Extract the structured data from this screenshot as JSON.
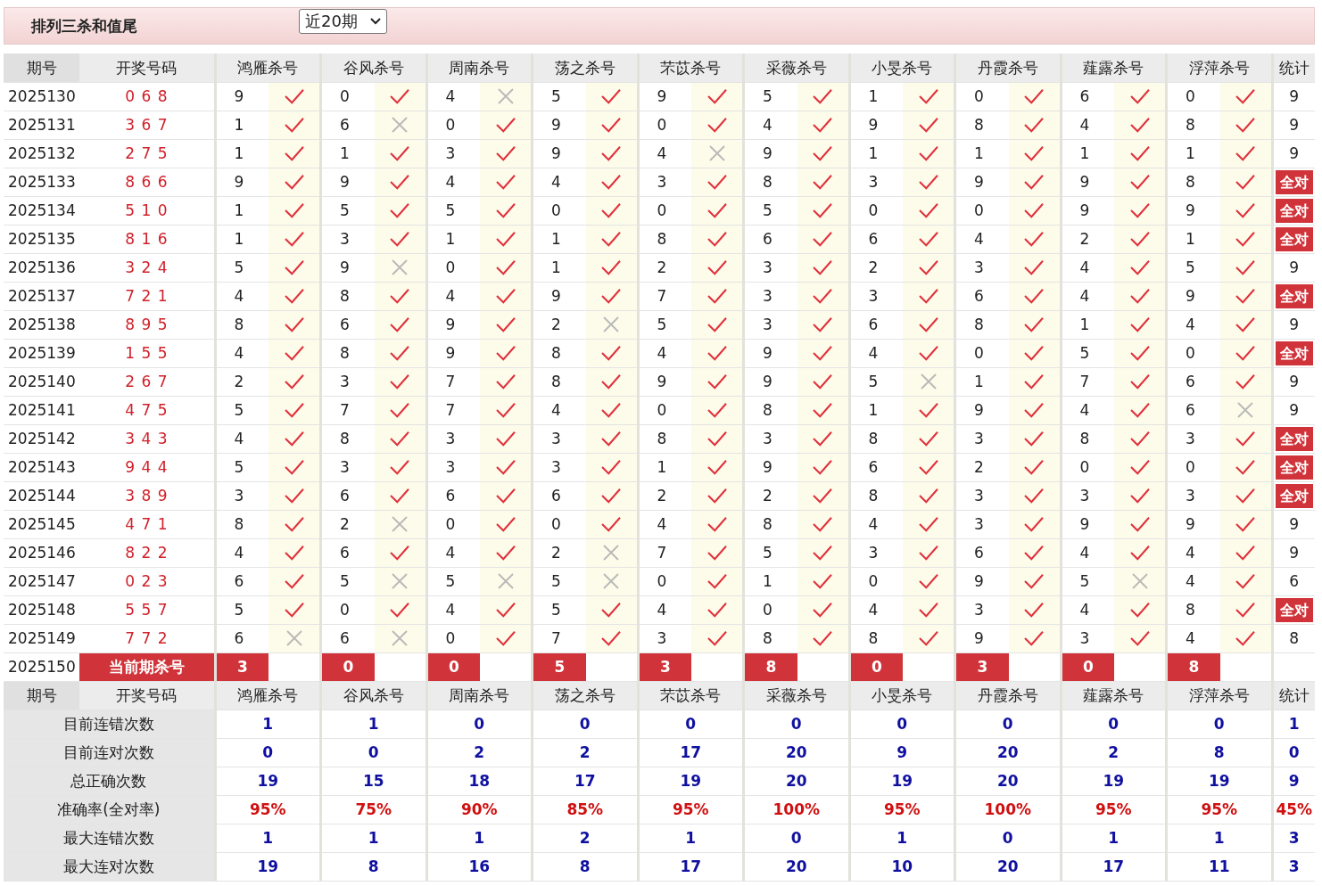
{
  "title": "排列三杀和值尾",
  "period_select": {
    "value": "近20期"
  },
  "columns": {
    "issue": "期号",
    "draw": "开奖号码",
    "experts": [
      "鸿雁杀号",
      "谷风杀号",
      "周南杀号",
      "荡之杀号",
      "芣苡杀号",
      "采薇杀号",
      "小旻杀号",
      "丹霞杀号",
      "薤露杀号",
      "浮萍杀号"
    ],
    "stat": "统计"
  },
  "rows": [
    {
      "issue": "2025130",
      "draw": "0 6 8",
      "kills": [
        {
          "n": "9",
          "hit": true
        },
        {
          "n": "0",
          "hit": true
        },
        {
          "n": "4",
          "hit": false
        },
        {
          "n": "5",
          "hit": true
        },
        {
          "n": "9",
          "hit": true
        },
        {
          "n": "5",
          "hit": true
        },
        {
          "n": "1",
          "hit": true
        },
        {
          "n": "0",
          "hit": true
        },
        {
          "n": "6",
          "hit": true
        },
        {
          "n": "0",
          "hit": true
        }
      ],
      "stat": {
        "text": "9",
        "all_correct": false
      }
    },
    {
      "issue": "2025131",
      "draw": "3 6 7",
      "kills": [
        {
          "n": "1",
          "hit": true
        },
        {
          "n": "6",
          "hit": false
        },
        {
          "n": "0",
          "hit": true
        },
        {
          "n": "9",
          "hit": true
        },
        {
          "n": "0",
          "hit": true
        },
        {
          "n": "4",
          "hit": true
        },
        {
          "n": "9",
          "hit": true
        },
        {
          "n": "8",
          "hit": true
        },
        {
          "n": "4",
          "hit": true
        },
        {
          "n": "8",
          "hit": true
        }
      ],
      "stat": {
        "text": "9",
        "all_correct": false
      }
    },
    {
      "issue": "2025132",
      "draw": "2 7 5",
      "kills": [
        {
          "n": "1",
          "hit": true
        },
        {
          "n": "1",
          "hit": true
        },
        {
          "n": "3",
          "hit": true
        },
        {
          "n": "9",
          "hit": true
        },
        {
          "n": "4",
          "hit": false
        },
        {
          "n": "9",
          "hit": true
        },
        {
          "n": "1",
          "hit": true
        },
        {
          "n": "1",
          "hit": true
        },
        {
          "n": "1",
          "hit": true
        },
        {
          "n": "1",
          "hit": true
        }
      ],
      "stat": {
        "text": "9",
        "all_correct": false
      }
    },
    {
      "issue": "2025133",
      "draw": "8 6 6",
      "kills": [
        {
          "n": "9",
          "hit": true
        },
        {
          "n": "9",
          "hit": true
        },
        {
          "n": "4",
          "hit": true
        },
        {
          "n": "4",
          "hit": true
        },
        {
          "n": "3",
          "hit": true
        },
        {
          "n": "8",
          "hit": true
        },
        {
          "n": "3",
          "hit": true
        },
        {
          "n": "9",
          "hit": true
        },
        {
          "n": "9",
          "hit": true
        },
        {
          "n": "8",
          "hit": true
        }
      ],
      "stat": {
        "text": "全对",
        "all_correct": true
      }
    },
    {
      "issue": "2025134",
      "draw": "5 1 0",
      "kills": [
        {
          "n": "1",
          "hit": true
        },
        {
          "n": "5",
          "hit": true
        },
        {
          "n": "5",
          "hit": true
        },
        {
          "n": "0",
          "hit": true
        },
        {
          "n": "0",
          "hit": true
        },
        {
          "n": "5",
          "hit": true
        },
        {
          "n": "0",
          "hit": true
        },
        {
          "n": "0",
          "hit": true
        },
        {
          "n": "9",
          "hit": true
        },
        {
          "n": "9",
          "hit": true
        }
      ],
      "stat": {
        "text": "全对",
        "all_correct": true
      }
    },
    {
      "issue": "2025135",
      "draw": "8 1 6",
      "kills": [
        {
          "n": "1",
          "hit": true
        },
        {
          "n": "3",
          "hit": true
        },
        {
          "n": "1",
          "hit": true
        },
        {
          "n": "1",
          "hit": true
        },
        {
          "n": "8",
          "hit": true
        },
        {
          "n": "6",
          "hit": true
        },
        {
          "n": "6",
          "hit": true
        },
        {
          "n": "4",
          "hit": true
        },
        {
          "n": "2",
          "hit": true
        },
        {
          "n": "1",
          "hit": true
        }
      ],
      "stat": {
        "text": "全对",
        "all_correct": true
      }
    },
    {
      "issue": "2025136",
      "draw": "3 2 4",
      "kills": [
        {
          "n": "5",
          "hit": true
        },
        {
          "n": "9",
          "hit": false
        },
        {
          "n": "0",
          "hit": true
        },
        {
          "n": "1",
          "hit": true
        },
        {
          "n": "2",
          "hit": true
        },
        {
          "n": "3",
          "hit": true
        },
        {
          "n": "2",
          "hit": true
        },
        {
          "n": "3",
          "hit": true
        },
        {
          "n": "4",
          "hit": true
        },
        {
          "n": "5",
          "hit": true
        }
      ],
      "stat": {
        "text": "9",
        "all_correct": false
      }
    },
    {
      "issue": "2025137",
      "draw": "7 2 1",
      "kills": [
        {
          "n": "4",
          "hit": true
        },
        {
          "n": "8",
          "hit": true
        },
        {
          "n": "4",
          "hit": true
        },
        {
          "n": "9",
          "hit": true
        },
        {
          "n": "7",
          "hit": true
        },
        {
          "n": "3",
          "hit": true
        },
        {
          "n": "3",
          "hit": true
        },
        {
          "n": "6",
          "hit": true
        },
        {
          "n": "4",
          "hit": true
        },
        {
          "n": "9",
          "hit": true
        }
      ],
      "stat": {
        "text": "全对",
        "all_correct": true
      }
    },
    {
      "issue": "2025138",
      "draw": "8 9 5",
      "kills": [
        {
          "n": "8",
          "hit": true
        },
        {
          "n": "6",
          "hit": true
        },
        {
          "n": "9",
          "hit": true
        },
        {
          "n": "2",
          "hit": false
        },
        {
          "n": "5",
          "hit": true
        },
        {
          "n": "3",
          "hit": true
        },
        {
          "n": "6",
          "hit": true
        },
        {
          "n": "8",
          "hit": true
        },
        {
          "n": "1",
          "hit": true
        },
        {
          "n": "4",
          "hit": true
        }
      ],
      "stat": {
        "text": "9",
        "all_correct": false
      }
    },
    {
      "issue": "2025139",
      "draw": "1 5 5",
      "kills": [
        {
          "n": "4",
          "hit": true
        },
        {
          "n": "8",
          "hit": true
        },
        {
          "n": "9",
          "hit": true
        },
        {
          "n": "8",
          "hit": true
        },
        {
          "n": "4",
          "hit": true
        },
        {
          "n": "9",
          "hit": true
        },
        {
          "n": "4",
          "hit": true
        },
        {
          "n": "0",
          "hit": true
        },
        {
          "n": "5",
          "hit": true
        },
        {
          "n": "0",
          "hit": true
        }
      ],
      "stat": {
        "text": "全对",
        "all_correct": true
      }
    },
    {
      "issue": "2025140",
      "draw": "2 6 7",
      "kills": [
        {
          "n": "2",
          "hit": true
        },
        {
          "n": "3",
          "hit": true
        },
        {
          "n": "7",
          "hit": true
        },
        {
          "n": "8",
          "hit": true
        },
        {
          "n": "9",
          "hit": true
        },
        {
          "n": "9",
          "hit": true
        },
        {
          "n": "5",
          "hit": false
        },
        {
          "n": "1",
          "hit": true
        },
        {
          "n": "7",
          "hit": true
        },
        {
          "n": "6",
          "hit": true
        }
      ],
      "stat": {
        "text": "9",
        "all_correct": false
      }
    },
    {
      "issue": "2025141",
      "draw": "4 7 5",
      "kills": [
        {
          "n": "5",
          "hit": true
        },
        {
          "n": "7",
          "hit": true
        },
        {
          "n": "7",
          "hit": true
        },
        {
          "n": "4",
          "hit": true
        },
        {
          "n": "0",
          "hit": true
        },
        {
          "n": "8",
          "hit": true
        },
        {
          "n": "1",
          "hit": true
        },
        {
          "n": "9",
          "hit": true
        },
        {
          "n": "4",
          "hit": true
        },
        {
          "n": "6",
          "hit": false
        }
      ],
      "stat": {
        "text": "9",
        "all_correct": false
      }
    },
    {
      "issue": "2025142",
      "draw": "3 4 3",
      "kills": [
        {
          "n": "4",
          "hit": true
        },
        {
          "n": "8",
          "hit": true
        },
        {
          "n": "3",
          "hit": true
        },
        {
          "n": "3",
          "hit": true
        },
        {
          "n": "8",
          "hit": true
        },
        {
          "n": "3",
          "hit": true
        },
        {
          "n": "8",
          "hit": true
        },
        {
          "n": "3",
          "hit": true
        },
        {
          "n": "8",
          "hit": true
        },
        {
          "n": "3",
          "hit": true
        }
      ],
      "stat": {
        "text": "全对",
        "all_correct": true
      }
    },
    {
      "issue": "2025143",
      "draw": "9 4 4",
      "kills": [
        {
          "n": "5",
          "hit": true
        },
        {
          "n": "3",
          "hit": true
        },
        {
          "n": "3",
          "hit": true
        },
        {
          "n": "3",
          "hit": true
        },
        {
          "n": "1",
          "hit": true
        },
        {
          "n": "9",
          "hit": true
        },
        {
          "n": "6",
          "hit": true
        },
        {
          "n": "2",
          "hit": true
        },
        {
          "n": "0",
          "hit": true
        },
        {
          "n": "0",
          "hit": true
        }
      ],
      "stat": {
        "text": "全对",
        "all_correct": true
      }
    },
    {
      "issue": "2025144",
      "draw": "3 8 9",
      "kills": [
        {
          "n": "3",
          "hit": true
        },
        {
          "n": "6",
          "hit": true
        },
        {
          "n": "6",
          "hit": true
        },
        {
          "n": "6",
          "hit": true
        },
        {
          "n": "2",
          "hit": true
        },
        {
          "n": "2",
          "hit": true
        },
        {
          "n": "8",
          "hit": true
        },
        {
          "n": "3",
          "hit": true
        },
        {
          "n": "3",
          "hit": true
        },
        {
          "n": "3",
          "hit": true
        }
      ],
      "stat": {
        "text": "全对",
        "all_correct": true
      }
    },
    {
      "issue": "2025145",
      "draw": "4 7 1",
      "kills": [
        {
          "n": "8",
          "hit": true
        },
        {
          "n": "2",
          "hit": false
        },
        {
          "n": "0",
          "hit": true
        },
        {
          "n": "0",
          "hit": true
        },
        {
          "n": "4",
          "hit": true
        },
        {
          "n": "8",
          "hit": true
        },
        {
          "n": "4",
          "hit": true
        },
        {
          "n": "3",
          "hit": true
        },
        {
          "n": "9",
          "hit": true
        },
        {
          "n": "9",
          "hit": true
        }
      ],
      "stat": {
        "text": "9",
        "all_correct": false
      }
    },
    {
      "issue": "2025146",
      "draw": "8 2 2",
      "kills": [
        {
          "n": "4",
          "hit": true
        },
        {
          "n": "6",
          "hit": true
        },
        {
          "n": "4",
          "hit": true
        },
        {
          "n": "2",
          "hit": false
        },
        {
          "n": "7",
          "hit": true
        },
        {
          "n": "5",
          "hit": true
        },
        {
          "n": "3",
          "hit": true
        },
        {
          "n": "6",
          "hit": true
        },
        {
          "n": "4",
          "hit": true
        },
        {
          "n": "4",
          "hit": true
        }
      ],
      "stat": {
        "text": "9",
        "all_correct": false
      }
    },
    {
      "issue": "2025147",
      "draw": "0 2 3",
      "kills": [
        {
          "n": "6",
          "hit": true
        },
        {
          "n": "5",
          "hit": false
        },
        {
          "n": "5",
          "hit": false
        },
        {
          "n": "5",
          "hit": false
        },
        {
          "n": "0",
          "hit": true
        },
        {
          "n": "1",
          "hit": true
        },
        {
          "n": "0",
          "hit": true
        },
        {
          "n": "9",
          "hit": true
        },
        {
          "n": "5",
          "hit": false
        },
        {
          "n": "4",
          "hit": true
        }
      ],
      "stat": {
        "text": "6",
        "all_correct": false
      }
    },
    {
      "issue": "2025148",
      "draw": "5 5 7",
      "kills": [
        {
          "n": "5",
          "hit": true
        },
        {
          "n": "0",
          "hit": true
        },
        {
          "n": "4",
          "hit": true
        },
        {
          "n": "5",
          "hit": true
        },
        {
          "n": "4",
          "hit": true
        },
        {
          "n": "0",
          "hit": true
        },
        {
          "n": "4",
          "hit": true
        },
        {
          "n": "3",
          "hit": true
        },
        {
          "n": "4",
          "hit": true
        },
        {
          "n": "8",
          "hit": true
        }
      ],
      "stat": {
        "text": "全对",
        "all_correct": true
      }
    },
    {
      "issue": "2025149",
      "draw": "7 7 2",
      "kills": [
        {
          "n": "6",
          "hit": false
        },
        {
          "n": "6",
          "hit": false
        },
        {
          "n": "0",
          "hit": true
        },
        {
          "n": "7",
          "hit": true
        },
        {
          "n": "3",
          "hit": true
        },
        {
          "n": "8",
          "hit": true
        },
        {
          "n": "8",
          "hit": true
        },
        {
          "n": "9",
          "hit": true
        },
        {
          "n": "3",
          "hit": true
        },
        {
          "n": "4",
          "hit": true
        }
      ],
      "stat": {
        "text": "8",
        "all_correct": false
      }
    }
  ],
  "current": {
    "issue": "2025150",
    "label": "当前期杀号",
    "kills": [
      "3",
      "0",
      "0",
      "5",
      "3",
      "8",
      "0",
      "3",
      "0",
      "8"
    ]
  },
  "summary_columns": {
    "issue": "期号",
    "draw": "开奖号码",
    "experts": [
      "鸿雁杀号",
      "谷风杀号",
      "周南杀号",
      "荡之杀号",
      "芣苡杀号",
      "采薇杀号",
      "小旻杀号",
      "丹霞杀号",
      "薤露杀号",
      "浮萍杀号"
    ],
    "stat": "统计"
  },
  "summary": [
    {
      "label": "目前连错次数",
      "kind": "count",
      "values": [
        "1",
        "1",
        "0",
        "0",
        "0",
        "0",
        "0",
        "0",
        "0",
        "0",
        "1"
      ]
    },
    {
      "label": "目前连对次数",
      "kind": "count",
      "values": [
        "0",
        "0",
        "2",
        "2",
        "17",
        "20",
        "9",
        "20",
        "2",
        "8",
        "0"
      ]
    },
    {
      "label": "总正确次数",
      "kind": "count",
      "values": [
        "19",
        "15",
        "18",
        "17",
        "19",
        "20",
        "19",
        "20",
        "19",
        "19",
        "9"
      ]
    },
    {
      "label": "准确率(全对率)",
      "kind": "percent",
      "values": [
        "95%",
        "75%",
        "90%",
        "85%",
        "95%",
        "100%",
        "95%",
        "100%",
        "95%",
        "95%",
        "45%"
      ]
    },
    {
      "label": "最大连错次数",
      "kind": "count",
      "values": [
        "1",
        "1",
        "1",
        "2",
        "1",
        "0",
        "1",
        "0",
        "1",
        "1",
        "3"
      ]
    },
    {
      "label": "最大连对次数",
      "kind": "count",
      "values": [
        "19",
        "8",
        "16",
        "8",
        "17",
        "20",
        "10",
        "20",
        "17",
        "11",
        "3"
      ]
    }
  ]
}
